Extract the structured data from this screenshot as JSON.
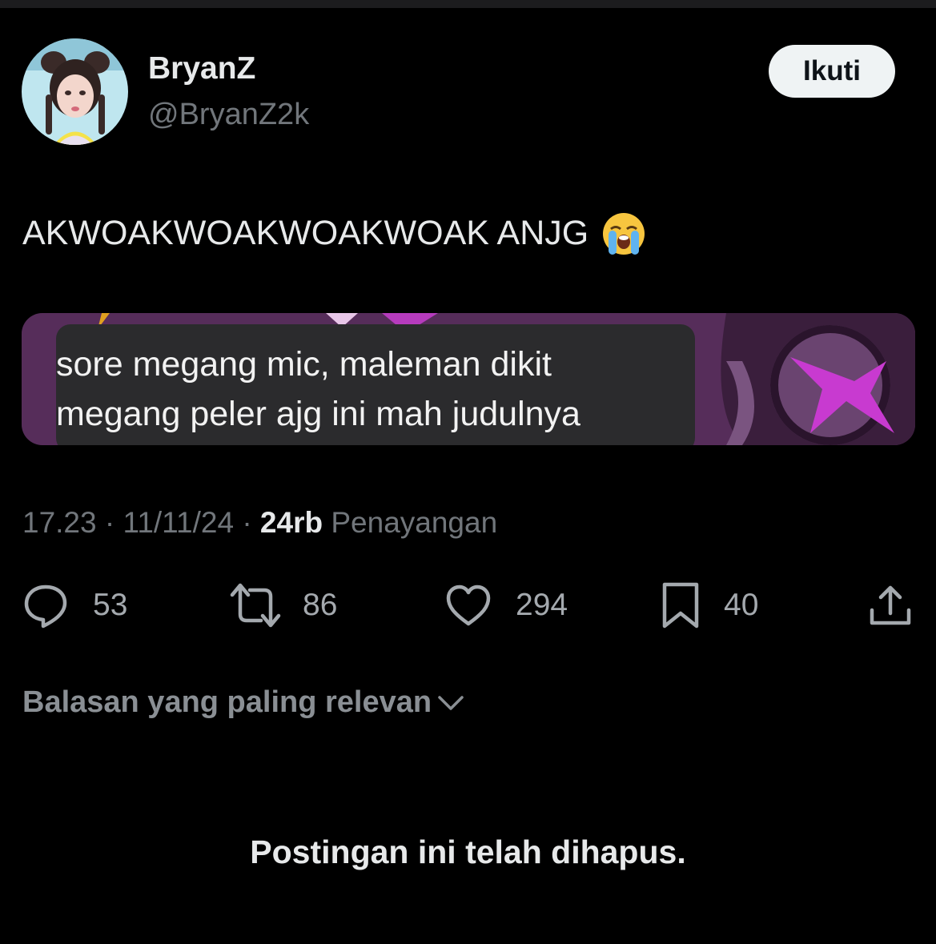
{
  "header": {
    "display_name": "BryanZ",
    "handle": "@BryanZ2k",
    "follow_label": "Ikuti"
  },
  "post": {
    "text": "AKWOAKWOAKWOAKWOAK ANJG",
    "emoji": "loudly-crying-face",
    "media_caption": [
      "sore megang mic, maleman dikit",
      "megang peler ajg ini mah judulnya"
    ]
  },
  "meta": {
    "time": "17.23",
    "separator": "·",
    "date": "11/11/24",
    "views_count": "24rb",
    "views_label": "Penayangan"
  },
  "actions": {
    "replies": "53",
    "reposts": "86",
    "likes": "294",
    "bookmarks": "40"
  },
  "replies_sort": {
    "label": "Balasan yang paling relevan"
  },
  "deleted_notice": "Postingan ini telah dihapus.",
  "colors": {
    "background": "#000000",
    "text_primary": "#e7e9ea",
    "text_secondary": "#71767b",
    "follow_button_bg": "#eff3f4",
    "media_purple": "#5a2e5c",
    "media_magenta": "#b63bbd"
  }
}
